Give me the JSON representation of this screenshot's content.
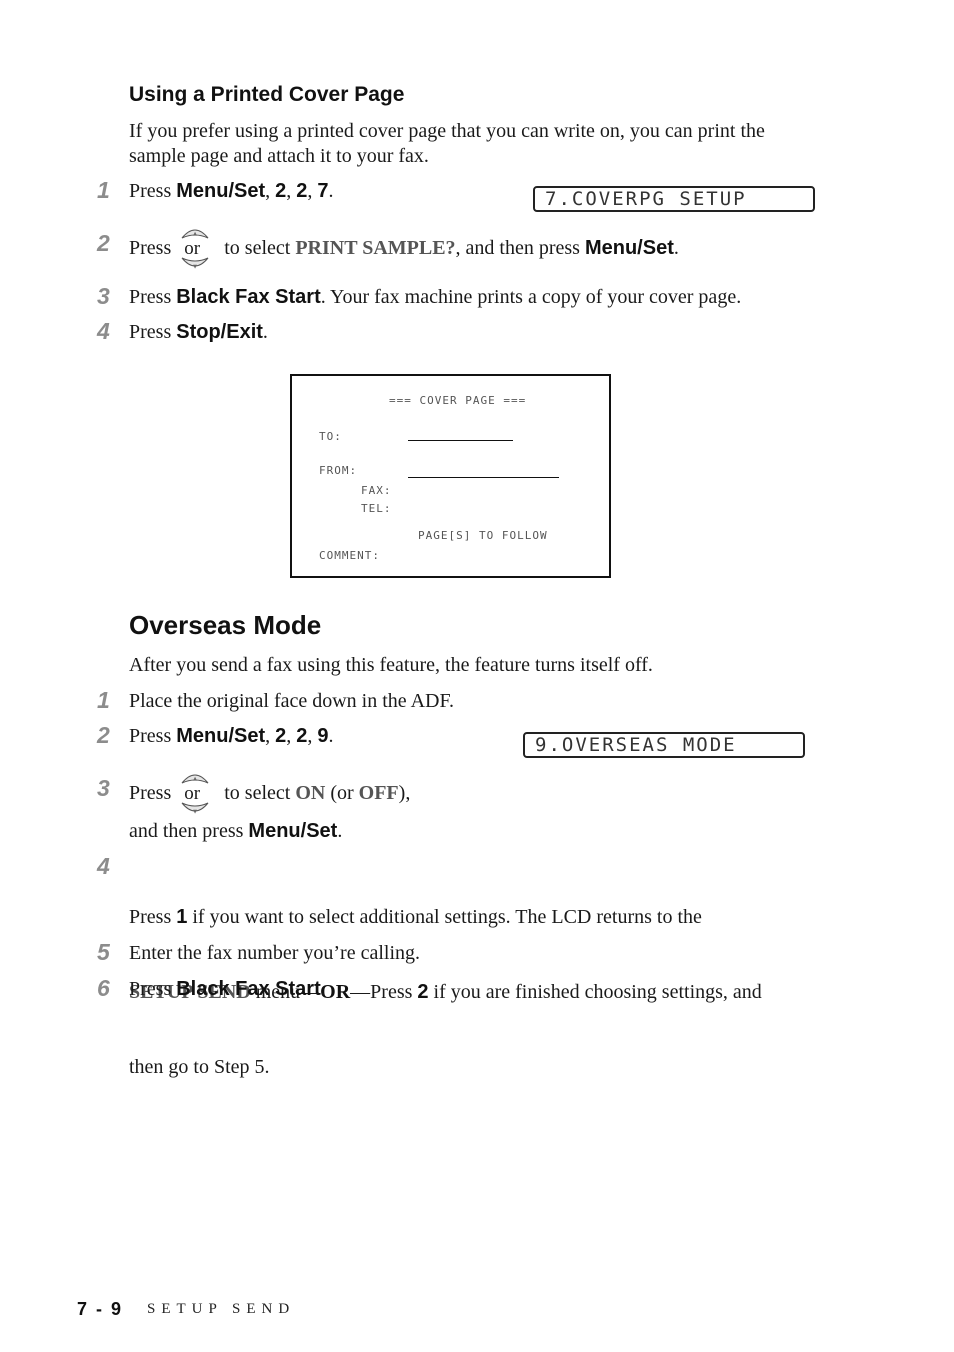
{
  "section1": {
    "heading": "Using a Printed Cover Page",
    "intro_line1": "If you prefer using a printed cover page that you can write on, you can print the",
    "intro_line2": "sample page and attach it to your fax.",
    "steps": [
      {
        "num": "1",
        "pre": "Press ",
        "b1": "Menu/Set",
        "s1": ", ",
        "b2": "2",
        "s2": ", ",
        "b3": "2",
        "s3": ", ",
        "b4": "7",
        "post": "."
      },
      {
        "num": "2",
        "pre": "Press",
        "icon_label": "or",
        "mid": " to select ",
        "gb": "PRINT SAMPLE?",
        "mid2": ", and then press ",
        "b": "Menu/Set",
        "post": "."
      },
      {
        "num": "3",
        "pre": "Press ",
        "b": "Black Fax Start",
        "post": ". Your fax machine prints a copy of your cover page."
      },
      {
        "num": "4",
        "pre": "Press ",
        "b": "Stop/Exit",
        "post": "."
      }
    ],
    "lcd": "7.COVERPG SETUP",
    "cover_page": {
      "title": "=== COVER PAGE ===",
      "to": "TO:",
      "from": "FROM:",
      "fax": "FAX:",
      "tel": "TEL:",
      "pages": "PAGE[S] TO FOLLOW",
      "comment": "COMMENT:"
    }
  },
  "section2": {
    "heading": "Overseas Mode",
    "intro": "After you send a fax using this feature, the feature turns itself off.",
    "steps": [
      {
        "num": "1",
        "text": "Place the original face down in the ADF."
      },
      {
        "num": "2",
        "pre": "Press ",
        "b1": "Menu/Set",
        "s1": ", ",
        "b2": "2",
        "s2": ", ",
        "b3": "2",
        "s3": ", ",
        "b4": "9",
        "post": "."
      },
      {
        "num": "3",
        "pre": "Press",
        "icon_label": "or",
        "mid": " to select ",
        "gb1": "ON",
        "mid2": " (or ",
        "gb2": "OFF",
        "post": "),",
        "line2_pre": "and then press ",
        "line2_b": "Menu/Set",
        "line2_post": "."
      },
      {
        "num": "4",
        "l1_pre": "Press ",
        "l1_b": "1",
        "l1_post": " if you want to select additional settings. The LCD returns to the",
        "l2_gb": "SETUP SEND",
        "l2_a": " menu—",
        "l2_kb": "OR",
        "l2_b": "—Press ",
        "l2_bold": "2",
        "l2_post": " if you are finished choosing settings, and",
        "l3": "then go to Step 5."
      },
      {
        "num": "5",
        "text": "Enter the fax number you’re calling."
      },
      {
        "num": "6",
        "pre": "Press ",
        "b": "Black Fax Start",
        "post": "."
      }
    ],
    "lcd": "9.OVERSEAS MODE"
  },
  "footer": {
    "page_number": "7 - 9",
    "section_title": "SETUP SEND"
  },
  "icons": {
    "nav_up_down": "up-down-arrow-keys-icon"
  },
  "colors": {
    "step_number": "#8c8c8c",
    "gray_bold": "#555555",
    "text": "#1a1a1a"
  }
}
